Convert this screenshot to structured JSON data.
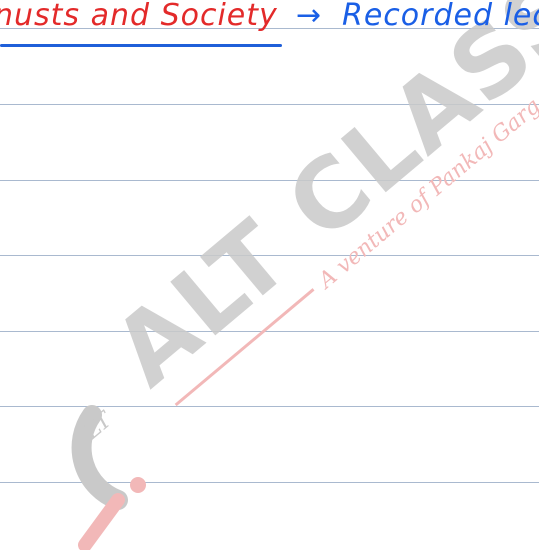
{
  "heading": {
    "red_text": "nusts and Society",
    "arrow": "→",
    "blue_text": "Recorded lec"
  },
  "watermark": {
    "brand": "ALT CLASSES",
    "tagline": "A venture of Pankaj Garg",
    "logo_letters": "LT"
  },
  "colors": {
    "red_ink": "#e32a2a",
    "blue_ink": "#1a5fe6",
    "underline_blue": "#1f5fd9",
    "ruled_line": "#a9b9cf",
    "watermark_gray": "#c9c9c9",
    "watermark_red": "#f2b8b8"
  }
}
